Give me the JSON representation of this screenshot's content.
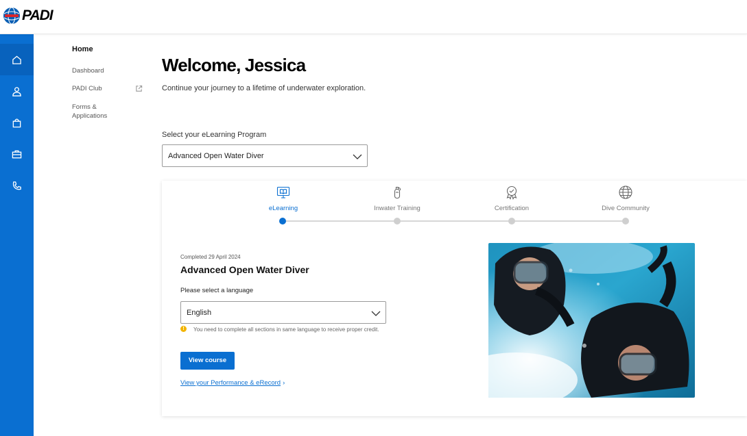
{
  "brand": {
    "name": "PADI",
    "accent": "#0a6fd1"
  },
  "rail": [
    {
      "icon": "home-icon",
      "active": true
    },
    {
      "icon": "user-icon",
      "active": false
    },
    {
      "icon": "shopping-bag-icon",
      "active": false
    },
    {
      "icon": "briefcase-icon",
      "active": false
    },
    {
      "icon": "phone-icon",
      "active": false
    }
  ],
  "subnav": {
    "home": "Home",
    "dashboard": "Dashboard",
    "padi_club": "PADI Club",
    "forms_line1": "Forms &",
    "forms_line2": "Applications"
  },
  "main": {
    "title": "Welcome, Jessica",
    "subtitle": "Continue your journey to a lifetime of underwater exploration.",
    "program_label": "Select your eLearning Program",
    "program_value": "Advanced Open Water Diver"
  },
  "stepper": {
    "steps": [
      {
        "label": "eLearning",
        "icon": "monitor-book-icon",
        "active": true
      },
      {
        "label": "Inwater Training",
        "icon": "scuba-tank-icon",
        "active": false
      },
      {
        "label": "Certification",
        "icon": "award-badge-icon",
        "active": false
      },
      {
        "label": "Dive Community",
        "icon": "globe-icon",
        "active": false
      }
    ]
  },
  "course": {
    "completed": "Completed 29 April 2024",
    "title": "Advanced Open Water Diver",
    "language_label": "Please select a language",
    "language_value": "English",
    "warning": "You need to complete all sections in same language to receive proper credit.",
    "view_button": "View course",
    "performance_link": "View your Performance & eRecord"
  }
}
